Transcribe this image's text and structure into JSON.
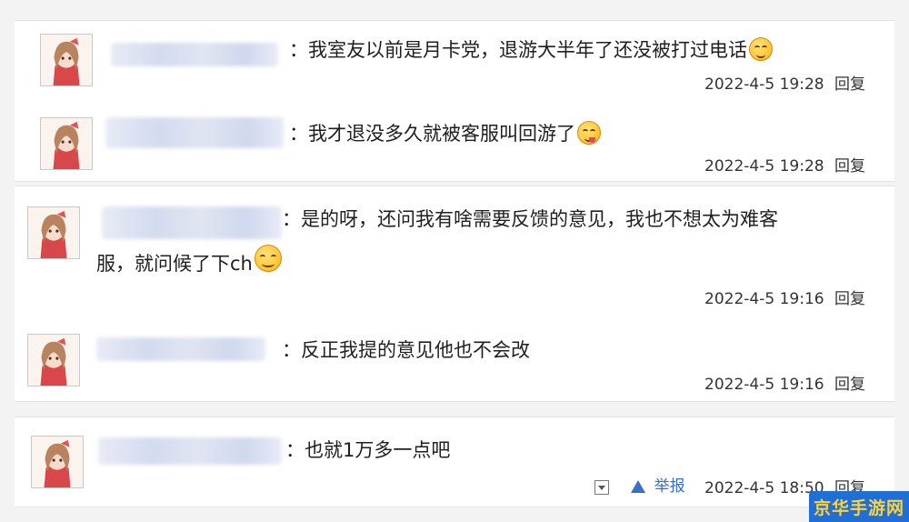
{
  "comments": [
    {
      "text": "：我室友以前是月卡党，退游大半年了还没被打过电话",
      "emoji": "grimace-emoji",
      "time": "2022-4-5 19:28",
      "reply": "回复"
    },
    {
      "text": "：我才退没多久就被客服叫回游了",
      "emoji": "tongue-emoji",
      "time": "2022-4-5 19:28",
      "reply": "回复"
    },
    {
      "text_line1": "：是的呀，还问我有啥需要反馈的意见，我也不想太为难客",
      "text_line2": "服，就问候了下ch",
      "emoji": "smile-emoji",
      "time": "2022-4-5 19:16",
      "reply": "回复"
    },
    {
      "text": "：反正我提的意见他也不会改",
      "time": "2022-4-5 19:16",
      "reply": "回复"
    },
    {
      "text": "：也就1万多一点吧",
      "report": "举报",
      "time": "2022-4-5 18:50",
      "reply": "回复"
    }
  ],
  "watermark": "京华手游网",
  "colors": {
    "link": "#3a6fc5",
    "watermark_bg": "#1f6fd6",
    "watermark_text": "#ffd23a"
  }
}
